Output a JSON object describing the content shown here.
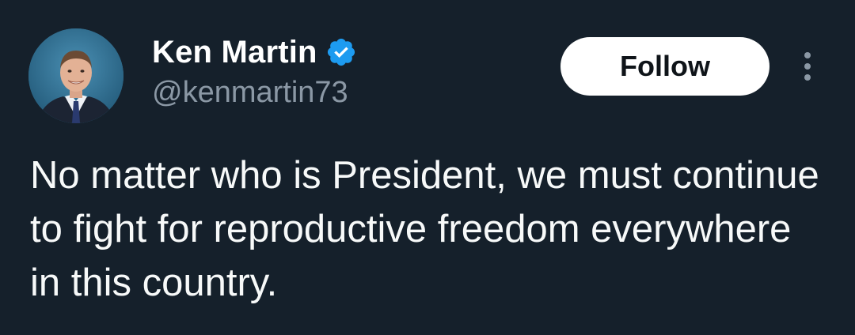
{
  "tweet": {
    "author": {
      "display_name": "Ken Martin",
      "handle": "@kenmartin73",
      "verified": true,
      "avatar_icon": "profile-photo"
    },
    "follow_label": "Follow",
    "more_icon": "more-vertical-icon",
    "text": "No matter who is President, we must continue to fight for reproductive freedom everywhere in this country."
  },
  "colors": {
    "background": "#15202b",
    "verified_blue": "#1d9bf0",
    "secondary_text": "#8b98a5",
    "follow_bg": "#ffffff",
    "follow_text": "#0f1419"
  }
}
